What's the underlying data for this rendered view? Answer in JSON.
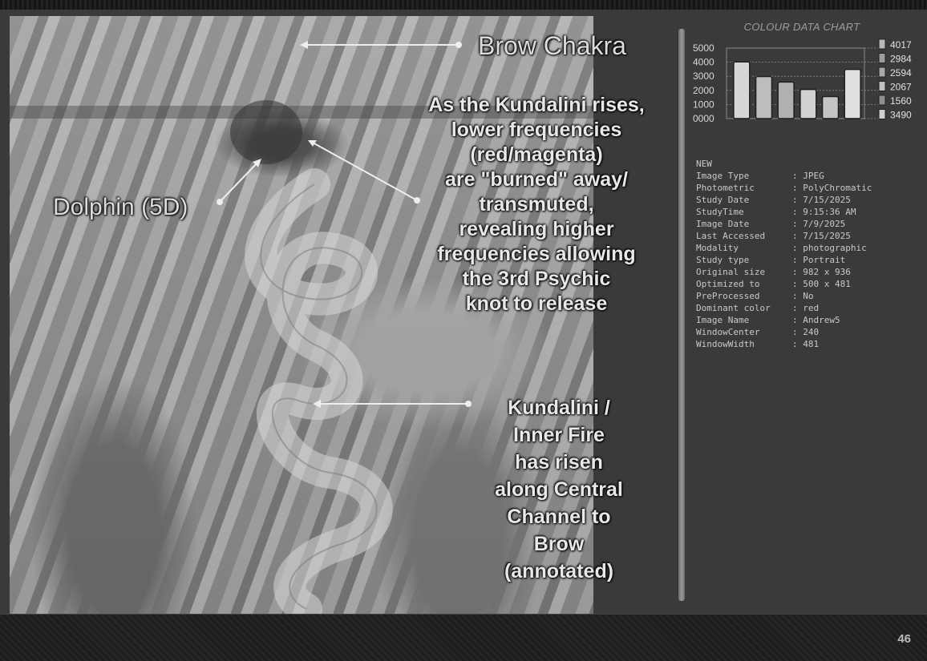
{
  "slide": {
    "page_number": "46"
  },
  "annotations": {
    "brow_chakra": "Brow Chakra",
    "dolphin": "Dolphin (5D)",
    "kundalini_rises": [
      "As the Kundalini rises,",
      "lower frequencies",
      "(red/magenta)",
      "are \"burned\" away/",
      "transmuted,",
      "revealing higher",
      "frequencies allowing",
      "the 3rd Psychic",
      "knot to release"
    ],
    "inner_fire": [
      "Kundalini /",
      "Inner Fire",
      "has risen",
      "along Central",
      "Channel to",
      "Brow",
      "(annotated)"
    ]
  },
  "chart_data": {
    "type": "bar",
    "title": "COLOUR DATA CHART",
    "y_ticks": [
      "5000",
      "4000",
      "3000",
      "2000",
      "1000",
      "0000"
    ],
    "ylim": [
      0,
      5000
    ],
    "values": [
      4017,
      2984,
      2594,
      2067,
      1560,
      3490
    ],
    "value_labels": [
      "4017",
      "2984",
      "2594",
      "2067",
      "1560",
      "3490"
    ],
    "bar_colors": [
      "#d6d6d6",
      "#bdbdbd",
      "#b0b0b0",
      "#d0d0d0",
      "#c4c4c4",
      "#e0e0e0"
    ],
    "legend_colors": [
      "#b8b8b8",
      "#9e9e9e",
      "#a8a8a8",
      "#c0c0c0",
      "#8f8f8f",
      "#d0d0d0"
    ],
    "grid": true,
    "legend_placement": "right"
  },
  "metadata": {
    "header": "NEW",
    "rows": [
      {
        "key": "Image Type",
        "value": ": JPEG"
      },
      {
        "key": "Photometric",
        "value": ": PolyChromatic"
      },
      {
        "key": "Study Date",
        "value": ": 7/15/2025"
      },
      {
        "key": "StudyTime",
        "value": ": 9:15:36 AM"
      },
      {
        "key": "Image Date",
        "value": ": 7/9/2025"
      },
      {
        "key": "Last Accessed",
        "value": ": 7/15/2025"
      },
      {
        "key": "Modality",
        "value": ": photographic"
      },
      {
        "key": "Study type",
        "value": ": Portrait"
      },
      {
        "key": "Original size",
        "value": ": 982 x 936"
      },
      {
        "key": "Optimized to",
        "value": ": 500 x 481"
      },
      {
        "key": "PreProcessed",
        "value": ": No"
      },
      {
        "key": "Dominant color",
        "value": ": red"
      },
      {
        "key": "Image Name",
        "value": ": Andrew5"
      },
      {
        "key": "WindowCenter",
        "value": ": 240"
      },
      {
        "key": "WindowWidth",
        "value": ": 481"
      }
    ]
  }
}
